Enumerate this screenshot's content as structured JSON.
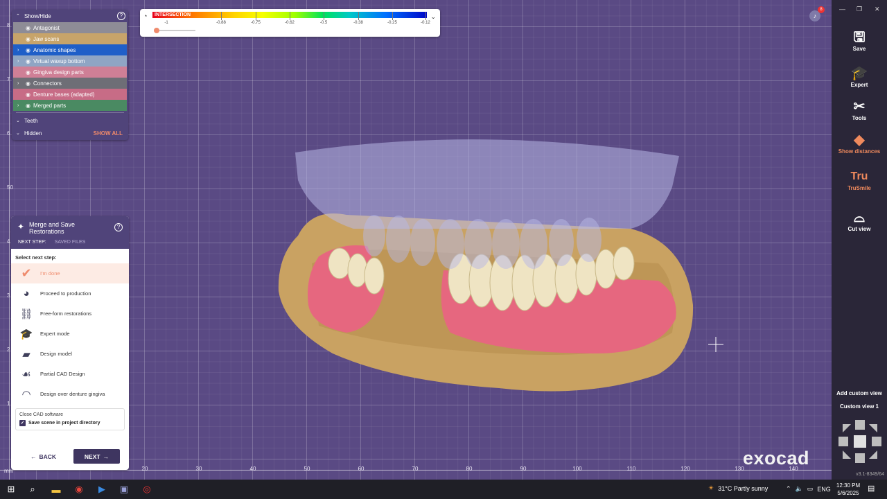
{
  "show_hide": {
    "title": "Show/Hide",
    "layers": [
      {
        "label": "Antagonist",
        "color": "#8e8c96",
        "chevron": false
      },
      {
        "label": "Jaw scans",
        "color": "#c7a46a",
        "chevron": false
      },
      {
        "label": "Anatomic shapes",
        "color": "#1f5fc8",
        "chevron": true
      },
      {
        "label": "Virtual waxup bottom",
        "color": "#8fa5c4",
        "chevron": true
      },
      {
        "label": "Gingiva design parts",
        "color": "#cf7f96",
        "chevron": false
      },
      {
        "label": "Connectors",
        "color": "#6e6e76",
        "chevron": true
      },
      {
        "label": "Denture bases (adapted)",
        "color": "#c76c86",
        "chevron": false
      },
      {
        "label": "Merged parts",
        "color": "#4a8a62",
        "chevron": true
      }
    ],
    "teeth_label": "Teeth",
    "hidden_label": "Hidden",
    "show_all_label": "SHOW ALL"
  },
  "intersection": {
    "title": "INTERSECTION",
    "ticks": [
      "-1",
      "-0.88",
      "-0.75",
      "-0.62",
      "-0.5",
      "-0.38",
      "-0.25",
      "-0.12"
    ]
  },
  "merge_panel": {
    "title": "Merge and Save Restorations",
    "tab_next": "NEXT STEP:",
    "tab_saved": "SAVED FILES",
    "select_label": "Select next step:",
    "steps": [
      {
        "label": "I'm done",
        "icon": "checkmark-icon",
        "selected": true
      },
      {
        "label": "Proceed to production",
        "icon": "production-icon",
        "selected": false
      },
      {
        "label": "Free-form restorations",
        "icon": "freeform-icon",
        "selected": false
      },
      {
        "label": "Expert mode",
        "icon": "graduation-cap-icon",
        "selected": false
      },
      {
        "label": "Design model",
        "icon": "design-model-icon",
        "selected": false
      },
      {
        "label": "Partial CAD Design",
        "icon": "partial-cad-icon",
        "selected": false
      },
      {
        "label": "Design over denture gingiva",
        "icon": "gingiva-icon",
        "selected": false
      }
    ],
    "close_label": "Close CAD software",
    "save_scene_label": "Save scene in project directory",
    "back_label": "BACK",
    "next_label": "NEXT"
  },
  "toolbar": {
    "items": [
      {
        "label": "Save",
        "icon": "save-icon"
      },
      {
        "label": "Expert",
        "icon": "graduation-cap-icon"
      },
      {
        "label": "Tools",
        "icon": "tools-icon"
      },
      {
        "label": "Show distances",
        "icon": "distances-icon"
      },
      {
        "label": "TruSmile",
        "icon": "trusmile-icon"
      },
      {
        "label": "Cut view",
        "icon": "cut-view-icon"
      }
    ],
    "trusmile_glyph": "Tru",
    "add_custom_view": "Add custom view",
    "custom_view_1": "Custom view 1",
    "version": "v3.1-8349/64"
  },
  "rulers": {
    "x_ticks": [
      "20",
      "30",
      "40",
      "50",
      "60",
      "70",
      "80",
      "90",
      "100",
      "110",
      "120",
      "130",
      "140"
    ],
    "y_ticks": [
      "8",
      "7",
      "6",
      "50",
      "4",
      "3",
      "2",
      "1"
    ],
    "unit": "mm"
  },
  "notification_count": "8",
  "logo": "exocad",
  "taskbar": {
    "weather": "31°C  Partly sunny",
    "language": "ENG",
    "time": "12:30 PM",
    "date": "5/6/2025"
  }
}
